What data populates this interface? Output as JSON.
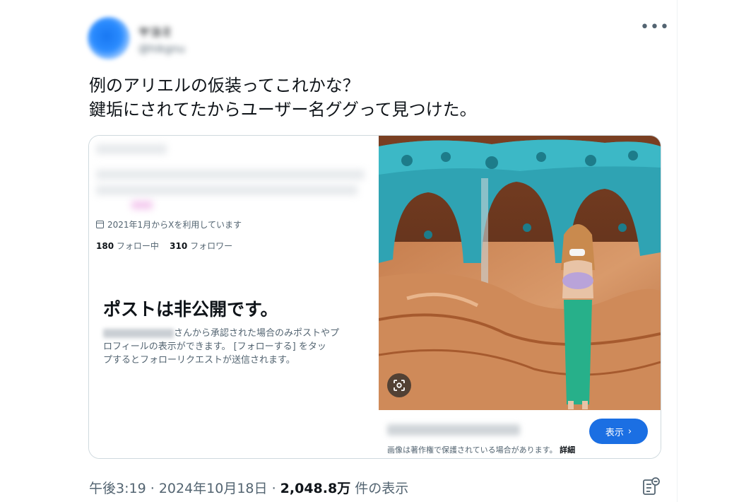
{
  "tweet": {
    "author_name": "ヤヨミ",
    "author_handle": "@hikgnu",
    "more_icon": "more-options-icon",
    "text_line1": "例のアリエルの仮装ってこれかな？",
    "text_line2": "鍵垢にされてたからユーザー名ググって見つけた。",
    "time": "午後3:19",
    "separator": "·",
    "date": "2024年10月18日",
    "views_number": "2,048.8万",
    "views_label": "件の表示"
  },
  "card": {
    "joined": "2021年1月からXを利用しています",
    "following_count": "180",
    "following_label": "フォロー中",
    "followers_count": "310",
    "followers_label": "フォロワー",
    "private_title": "ポストは非公開です。",
    "private_desc_1": "さんから承認された場合のみポストやプ",
    "private_desc_2": "ロフィールの表示ができます。 [フォローする] をタッ",
    "private_desc_3": "プするとフォローリクエストが送信されます。",
    "view_button": "表示",
    "copyright_note": "画像は著作権で保護されている場合があります。",
    "details_link": "詳細"
  },
  "colors": {
    "accent": "#1b6fe3",
    "text_primary": "#0f1419",
    "text_secondary": "#536471",
    "border": "#cfd9de"
  }
}
